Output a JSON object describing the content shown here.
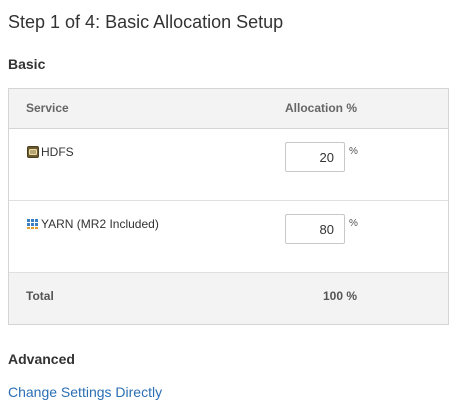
{
  "title": "Step 1 of 4: Basic Allocation Setup",
  "sections": {
    "basic": "Basic",
    "advanced": "Advanced"
  },
  "table": {
    "headers": {
      "service": "Service",
      "allocation": "Allocation %"
    },
    "rows": [
      {
        "service": "HDFS",
        "icon": "hdfs-icon",
        "allocation": "20",
        "unit": "%"
      },
      {
        "service": "YARN (MR2 Included)",
        "icon": "yarn-icon",
        "allocation": "80",
        "unit": "%"
      }
    ],
    "total": {
      "label": "Total",
      "value": "100 %"
    }
  },
  "links": {
    "change_settings": "Change Settings Directly"
  },
  "colors": {
    "link": "#2a6fb5",
    "table_border": "#d5d5d5",
    "header_bg": "#f3f3f3"
  }
}
